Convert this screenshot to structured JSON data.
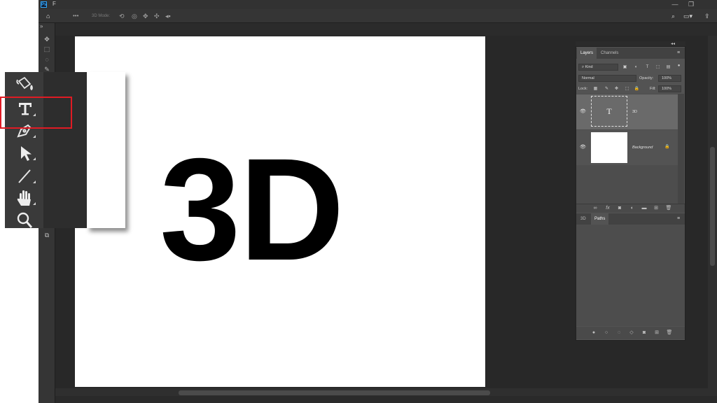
{
  "app": {
    "logo": "Ps",
    "menu_first": "F",
    "window_controls": [
      "—",
      "❐"
    ]
  },
  "options_bar": {
    "home_icon": "home-icon",
    "more": "•••",
    "mode_label": "3D Mode:",
    "mode_icons": [
      "orbit-icon",
      "roll-icon",
      "pan-icon",
      "slide-icon",
      "scale-icon"
    ],
    "right_icons": [
      "search-icon",
      "workspace-icon",
      "share-icon"
    ]
  },
  "toolbar": {
    "collapse": "»",
    "icons": [
      "move-icon",
      "marquee-icon",
      "lasso-icon",
      "quick-select-icon"
    ],
    "bottom_icon": "screen-mode-icon"
  },
  "zoom_inset": {
    "tools": [
      {
        "name": "paint-bucket-icon",
        "glyph": "🪣"
      },
      {
        "name": "type-tool-icon",
        "glyph": "T"
      },
      {
        "name": "pen-tool-icon",
        "glyph": "✒"
      },
      {
        "name": "path-selection-icon",
        "glyph": "➤"
      },
      {
        "name": "line-tool-icon",
        "glyph": "╱"
      },
      {
        "name": "hand-tool-icon",
        "glyph": "✋"
      },
      {
        "name": "zoom-tool-icon",
        "glyph": "🔍"
      }
    ],
    "highlighted_tool": "type-tool-icon",
    "highlight_color": "#e01b24"
  },
  "canvas": {
    "text": "3D",
    "text_color": "#000000",
    "background": "#ffffff"
  },
  "layers_panel": {
    "tabs": [
      {
        "label": "Layers",
        "active": true
      },
      {
        "label": "Channels",
        "active": false
      }
    ],
    "filter_label": "Kind",
    "blend_mode": "Normal",
    "opacity_label": "Opacity:",
    "opacity_value": "100%",
    "lock_label": "Lock:",
    "fill_label": "Fill:",
    "fill_value": "100%",
    "layers": [
      {
        "name": "3D",
        "type": "text",
        "thumb_glyph": "T",
        "selected": true
      },
      {
        "name": "Background",
        "type": "image",
        "locked": true,
        "selected": false
      }
    ],
    "footer_icons": [
      "link-icon",
      "fx-icon",
      "mask-icon",
      "adjustment-icon",
      "group-icon",
      "new-layer-icon",
      "trash-icon"
    ]
  },
  "paths_panel": {
    "tabs": [
      {
        "label": "3D",
        "active": false
      },
      {
        "label": "Paths",
        "active": true
      }
    ],
    "footer_icons": [
      "fill-path-icon",
      "stroke-path-icon",
      "load-selection-icon",
      "make-path-icon",
      "mask-icon",
      "new-path-icon",
      "trash-icon"
    ]
  }
}
